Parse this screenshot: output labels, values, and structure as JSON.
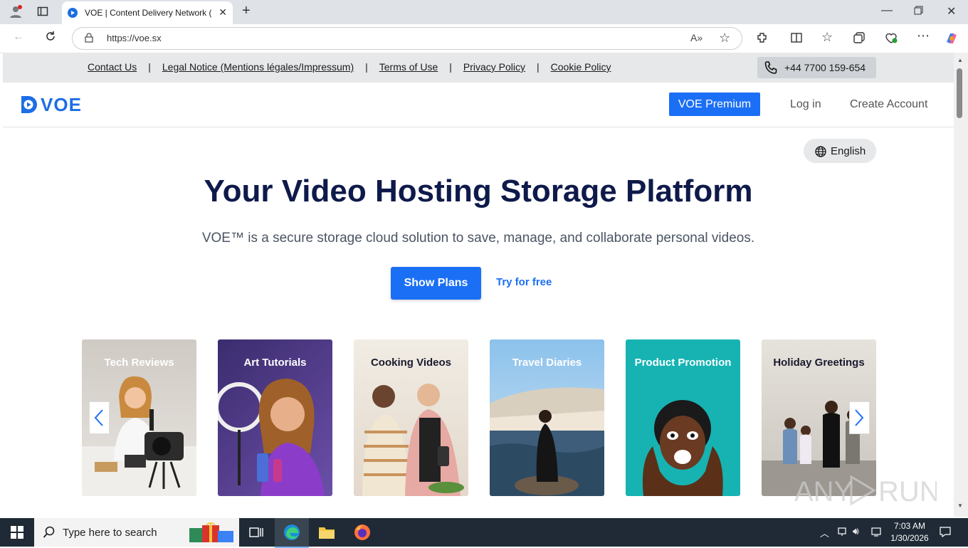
{
  "browser": {
    "tab_title": "VOE | Content Delivery Network (",
    "url": "https://voe.sx"
  },
  "topbar": {
    "links": [
      "Contact Us",
      "Legal Notice (Mentions légales/Impressum)",
      "Terms of Use",
      "Privacy Policy",
      "Cookie Policy"
    ],
    "phone": "+44 7700 159-654"
  },
  "header": {
    "logo_text": "VOE",
    "premium_label": "VOE Premium",
    "login_label": "Log in",
    "create_label": "Create Account"
  },
  "language": "English",
  "hero": {
    "title": "Your Video Hosting Storage Platform",
    "subtitle": "VOE™ is a secure storage cloud solution to save, manage, and collaborate personal videos.",
    "plans_label": "Show Plans",
    "try_label": "Try for free"
  },
  "cards": [
    {
      "title": "Tech Reviews"
    },
    {
      "title": "Art Tutorials"
    },
    {
      "title": "Cooking Videos"
    },
    {
      "title": "Travel Diaries"
    },
    {
      "title": "Product Promotion"
    },
    {
      "title": "Holiday Greetings"
    }
  ],
  "taskbar": {
    "search_placeholder": "Type here to search",
    "time": "7:03 AM",
    "date": "1/30/2026"
  },
  "colors": {
    "accent": "#1b6ff5",
    "title": "#0e1a4a",
    "taskbar": "#1f2a36"
  }
}
